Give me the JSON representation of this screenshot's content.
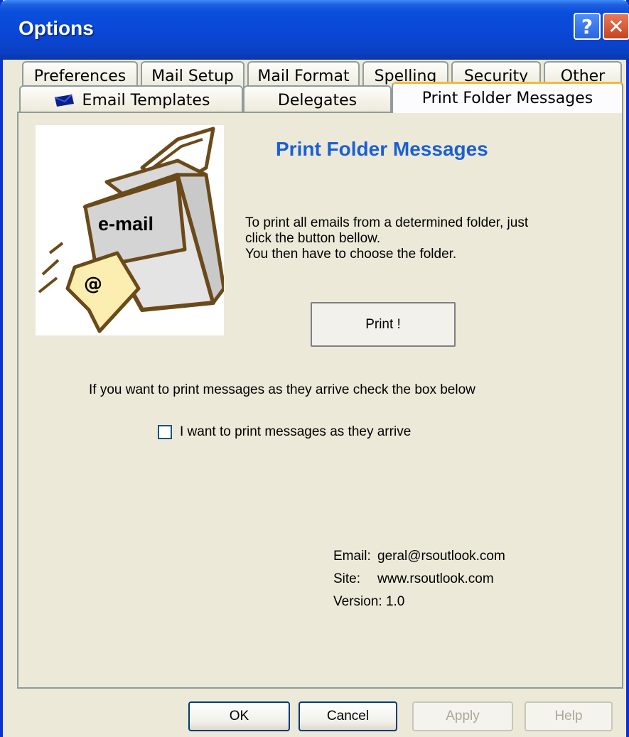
{
  "window": {
    "title": "Options",
    "help_glyph": "?",
    "close_glyph": "✕"
  },
  "tabs": {
    "row1": [
      "Preferences",
      "Mail Setup",
      "Mail Format",
      "Spelling",
      "Security",
      "Other"
    ],
    "row2": [
      "Email Templates",
      "Delegates",
      "Print Folder Messages"
    ],
    "active": "Print Folder Messages"
  },
  "image": {
    "label": "e-mail",
    "at_symbol": "@"
  },
  "main": {
    "heading": "Print Folder Messages",
    "description": [
      "To print all emails from a determined folder, just",
      "click the button bellow.",
      "You then have to choose the folder."
    ],
    "print_button": "Print !",
    "auto_print_hint": "If you want to print messages as they arrive check the box below",
    "checkbox_label": "I want to print messages as they arrive",
    "checkbox_checked": false
  },
  "contact": {
    "email_label": "Email:",
    "email_value": "geral@rsoutlook.com",
    "site_label": "Site:",
    "site_value": "www.rsoutlook.com",
    "version_label": "Version:",
    "version_value": "1.0"
  },
  "footer": {
    "ok": "OK",
    "cancel": "Cancel",
    "apply": "Apply",
    "help": "Help"
  },
  "colors": {
    "titlebar": "#0a46d4",
    "heading": "#1b5fd6",
    "active_tab_accent": "#f7b93a",
    "dialog_bg": "#ece9d8"
  }
}
